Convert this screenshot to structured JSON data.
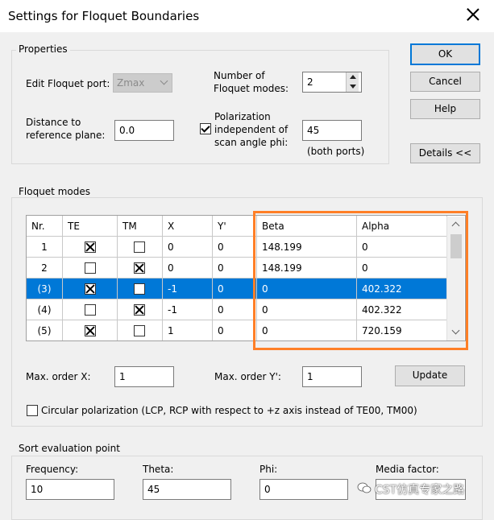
{
  "window": {
    "title": "Settings for Floquet Boundaries"
  },
  "buttons": {
    "ok": "OK",
    "cancel": "Cancel",
    "help": "Help",
    "details": "Details <<",
    "update": "Update"
  },
  "properties": {
    "group_label": "Properties",
    "edit_port_label": "Edit Floquet port:",
    "edit_port_value": "Zmax",
    "num_modes_label": "Number of\nFloquet modes:",
    "num_modes_value": "2",
    "distance_label": "Distance to\nreference plane:",
    "distance_value": "0.0",
    "polarization_label": "Polarization\nindependent of\nscan angle phi:",
    "polarization_checked": true,
    "polarization_value": "45",
    "both_ports": "(both ports)"
  },
  "floquet": {
    "group_label": "Floquet modes",
    "columns": [
      "Nr.",
      "TE",
      "TM",
      "X",
      "Y'",
      "Beta",
      "Alpha"
    ],
    "rows": [
      {
        "nr": "1",
        "te": true,
        "tm": false,
        "x": "0",
        "y": "0",
        "beta": "148.199",
        "alpha": "0",
        "selected": false
      },
      {
        "nr": "2",
        "te": false,
        "tm": true,
        "x": "0",
        "y": "0",
        "beta": "148.199",
        "alpha": "0",
        "selected": false
      },
      {
        "nr": "(3)",
        "te": true,
        "tm": false,
        "x": "-1",
        "y": "0",
        "beta": "0",
        "alpha": "402.322",
        "selected": true
      },
      {
        "nr": "(4)",
        "te": false,
        "tm": true,
        "x": "-1",
        "y": "0",
        "beta": "0",
        "alpha": "402.322",
        "selected": false
      },
      {
        "nr": "(5)",
        "te": true,
        "tm": false,
        "x": "1",
        "y": "0",
        "beta": "0",
        "alpha": "720.159",
        "selected": false
      }
    ],
    "max_x_label": "Max. order X:",
    "max_x_value": "1",
    "max_y_label": "Max. order Y':",
    "max_y_value": "1",
    "circular_label": "Circular polarization (LCP, RCP with respect to +z axis instead of TE00, TM00)"
  },
  "sort": {
    "group_label": "Sort evaluation point",
    "frequency_label": "Frequency:",
    "frequency_value": "10",
    "theta_label": "Theta:",
    "theta_value": "45",
    "phi_label": "Phi:",
    "phi_value": "0",
    "media_label": "Media factor:"
  },
  "watermark": "CST仿真专家之路",
  "colors": {
    "selection": "#0078d7",
    "highlight": "#ff7f27",
    "default_button": "#0078d7"
  }
}
